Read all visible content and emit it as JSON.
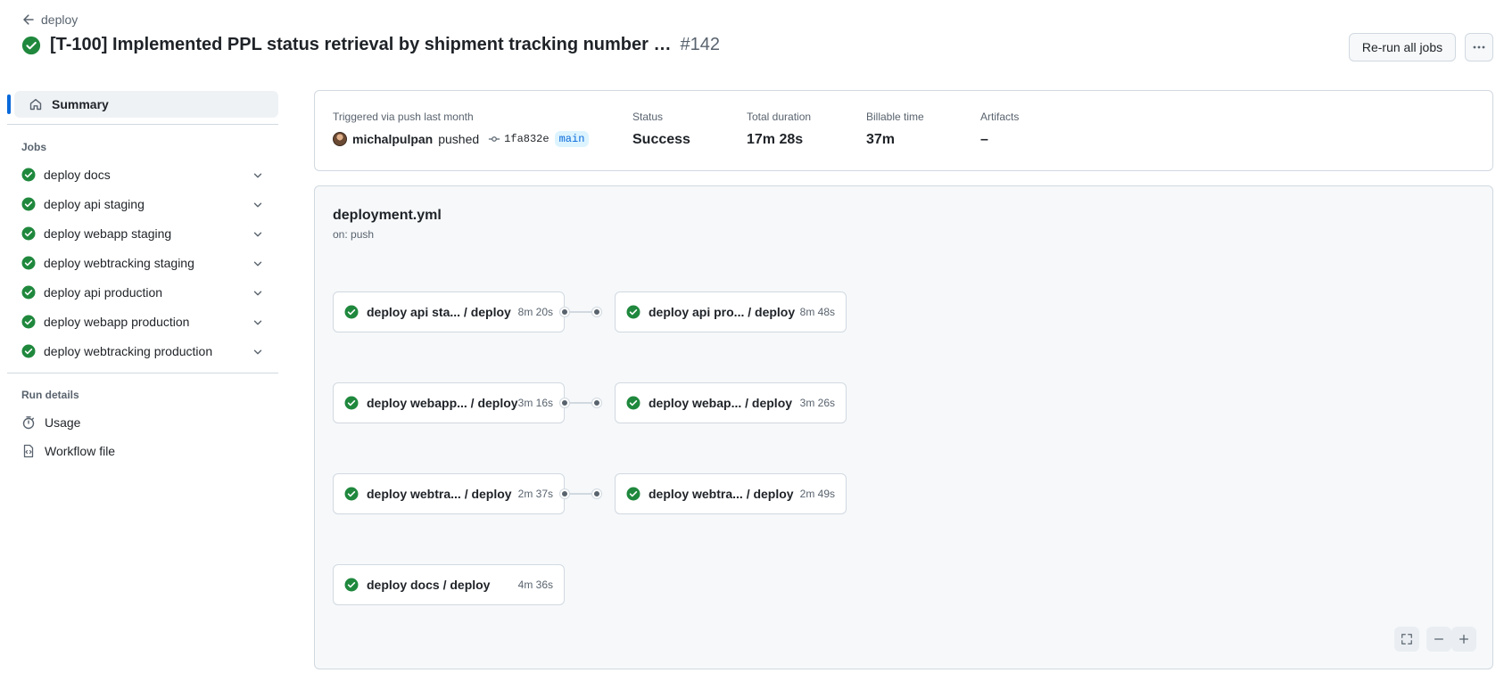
{
  "header": {
    "back_label": "deploy",
    "title": "[T-100] Implemented PPL status retrieval by shipment tracking number …",
    "run_number": "#142",
    "rerun_label": "Re-run all jobs"
  },
  "sidebar": {
    "summary_label": "Summary",
    "jobs_heading": "Jobs",
    "jobs": [
      {
        "label": "deploy docs"
      },
      {
        "label": "deploy api staging"
      },
      {
        "label": "deploy webapp staging"
      },
      {
        "label": "deploy webtracking staging"
      },
      {
        "label": "deploy api production"
      },
      {
        "label": "deploy webapp production"
      },
      {
        "label": "deploy webtracking production"
      }
    ],
    "run_details_heading": "Run details",
    "usage_label": "Usage",
    "workflow_file_label": "Workflow file"
  },
  "summary": {
    "triggered_label": "Triggered via push last month",
    "actor": "michalpulpan",
    "action": "pushed",
    "commit": "1fa832e",
    "branch": "main",
    "status_label": "Status",
    "status_value": "Success",
    "duration_label": "Total duration",
    "duration_value": "17m 28s",
    "billable_label": "Billable time",
    "billable_value": "37m",
    "artifacts_label": "Artifacts",
    "artifacts_value": "–"
  },
  "graph": {
    "workflow_name": "deployment.yml",
    "workflow_trigger": "on: push",
    "nodes": [
      {
        "name": "deploy api sta...  / deploy",
        "duration": "8m 20s"
      },
      {
        "name": "deploy api pro...  / deploy",
        "duration": "8m 48s"
      },
      {
        "name": "deploy webapp... / deploy",
        "duration": "3m 16s"
      },
      {
        "name": "deploy webap...  / deploy",
        "duration": "3m 26s"
      },
      {
        "name": "deploy webtra...  / deploy",
        "duration": "2m 37s"
      },
      {
        "name": "deploy webtra...  / deploy",
        "duration": "2m 49s"
      },
      {
        "name": "deploy docs / deploy",
        "duration": "4m 36s"
      }
    ]
  },
  "colors": {
    "success": "#1f883d",
    "accent": "#0969da",
    "muted": "#59636e"
  },
  "icons": {
    "success": "check-circle-fill-icon",
    "back": "arrow-left-icon",
    "home": "home-icon",
    "usage": "stopwatch-icon",
    "workflow": "file-code-icon",
    "expand": "chevron-down-icon"
  }
}
